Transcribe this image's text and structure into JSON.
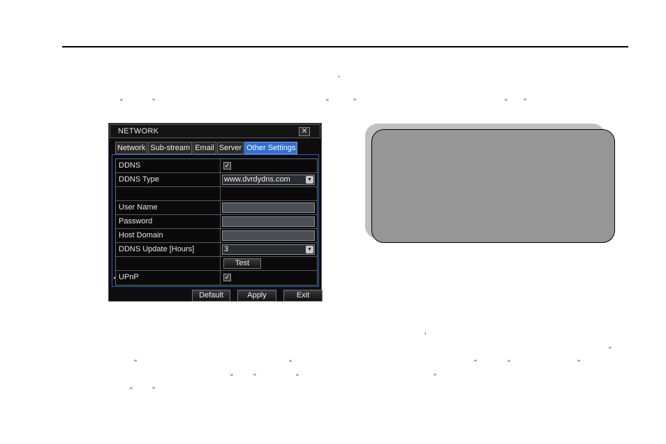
{
  "page": {
    "marks": {
      "apostrophe_1": "’",
      "q1_open": "“",
      "q1_close": "”",
      "q2_open": "“",
      "q2_close": "”",
      "q3_open": "“",
      "q3_close": "”",
      "apostrophe_2": "’",
      "q4_open": "“",
      "q5_close": "”",
      "q6_open": "“",
      "q7_close": "”",
      "q8_open": "“",
      "q8_close": "”",
      "q9_open": "“",
      "q9_close": "”",
      "q10_open": "“",
      "q10_close": "”",
      "q11_open": "“",
      "q11_close": "”"
    }
  },
  "dialog": {
    "title": "NETWORK",
    "close_glyph": "✕",
    "tabs": [
      {
        "label": "Network",
        "active": false
      },
      {
        "label": "Sub-stream",
        "active": false
      },
      {
        "label": "Email",
        "active": false
      },
      {
        "label": "Server",
        "active": false
      },
      {
        "label": "Other Settings",
        "active": true
      }
    ],
    "rows": {
      "ddns": {
        "label": "DDNS",
        "checked": true,
        "check_glyph": "✓"
      },
      "ddns_type": {
        "label": "DDNS Type",
        "value": "www.dvrdydns.com",
        "arrow": "▼"
      },
      "blank": {
        "label": ""
      },
      "user_name": {
        "label": "User Name",
        "value": ""
      },
      "password": {
        "label": "Password",
        "value": ""
      },
      "host_domain": {
        "label": "Host Domain",
        "value": ""
      },
      "ddns_update": {
        "label": "DDNS Update [Hours]",
        "value": "3",
        "arrow": "▼"
      },
      "test": {
        "button": "Test"
      },
      "upnp": {
        "label": "UPnP",
        "checked": true,
        "check_glyph": "✓"
      }
    },
    "buttons": {
      "default": "Default",
      "apply": "Apply",
      "exit": "Exit"
    }
  },
  "note_box": {
    "text": ""
  }
}
